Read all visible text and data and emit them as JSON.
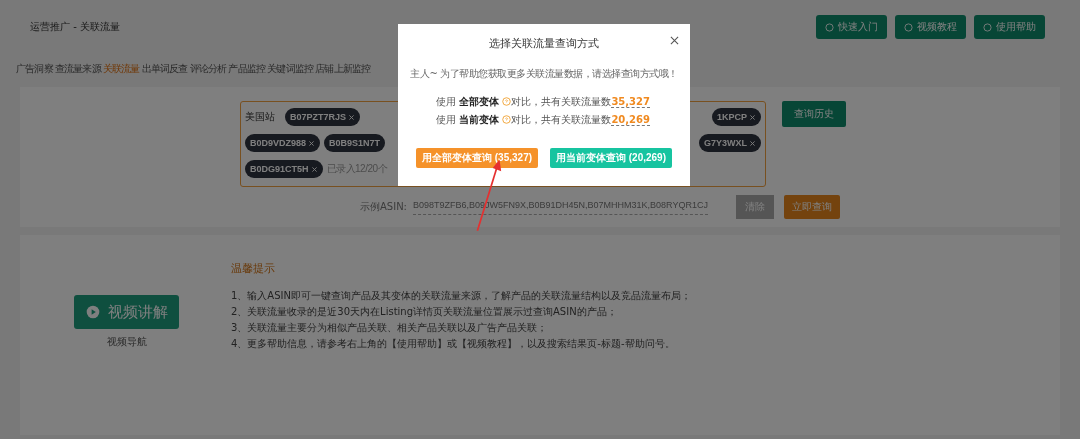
{
  "breadcrumb": "运营推广 - 关联流量",
  "header_buttons": [
    {
      "label": "快速入门"
    },
    {
      "label": "视频教程"
    },
    {
      "label": "使用帮助"
    }
  ],
  "tabs": [
    {
      "label": "广告洞察",
      "selected": false
    },
    {
      "label": "查流量来源",
      "selected": false
    },
    {
      "label": "关联流量",
      "selected": true
    },
    {
      "label": "出单词反查",
      "selected": false
    },
    {
      "label": "评论分析",
      "selected": false
    },
    {
      "label": "产品监控",
      "selected": false
    },
    {
      "label": "关键词监控",
      "selected": false
    },
    {
      "label": "店铺上新监控",
      "selected": false
    }
  ],
  "search": {
    "marketplace": "美国站",
    "chip_rows": [
      {
        "left": [
          {
            "text": "B07PZT7RJS",
            "removable": true
          }
        ],
        "right": [
          {
            "text": "1KPCP",
            "removable": true
          }
        ]
      },
      {
        "left": [
          {
            "text": "B0D9VDZ988",
            "removable": true
          },
          {
            "text": "B0B9S1N7T",
            "removable": false
          }
        ],
        "right": [
          {
            "text": "G7Y3WXL",
            "removable": true
          }
        ]
      },
      {
        "left": [
          {
            "text": "B0DG91CT5H",
            "removable": true
          }
        ],
        "right": []
      }
    ],
    "count_note": "已录入12/20个",
    "history_button": "查询历史",
    "example_label": "示例ASIN:",
    "example_asins": "B098T9ZFB6,B09JW5FN9X,B0B91DH45N,B07MHHM31K,B08RYQR1CJ",
    "clear_button": "清除",
    "query_button": "立即查询"
  },
  "video": {
    "button": "视频讲解",
    "caption": "视频导航"
  },
  "tips": {
    "title": "温馨提示",
    "items": [
      "1、输入ASIN即可一键查询产品及其变体的关联流量来源，了解产品的关联流量结构以及竞品流量布局；",
      "2、关联流量收录的是近30天内在Listing详情页关联流量位置展示过查询ASIN的产品；",
      "3、关联流量主要分为相似产品关联、相关产品关联以及广告产品关联；",
      "4、更多帮助信息，请参考右上角的【使用帮助】或【视频教程】，以及搜索结果页-标题-帮助问号。"
    ]
  },
  "dialog": {
    "title": "选择关联流量查询方式",
    "intro": "主人~ 为了帮助您获取更多关联流量数据，请选择查询方式哦！",
    "options": [
      {
        "prefix": "使用",
        "variant": "全部变体",
        "suffix": "对比，共有关联流量数",
        "count": "35,327"
      },
      {
        "prefix": "使用",
        "variant": "当前变体",
        "suffix": "对比，共有关联流量数",
        "count": "20,269"
      }
    ],
    "buttons": [
      {
        "kind": "primary",
        "label": "用全部变体查询 (35,327)"
      },
      {
        "kind": "secondary",
        "label": "用当前变体查询 (20,269)"
      }
    ]
  }
}
